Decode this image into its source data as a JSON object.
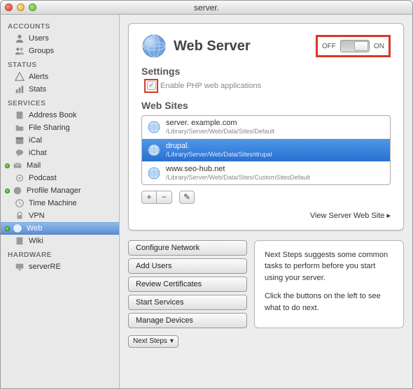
{
  "window": {
    "title": "server."
  },
  "sidebar": {
    "accounts_header": "ACCOUNTS",
    "accounts": [
      {
        "label": "Users"
      },
      {
        "label": "Groups"
      }
    ],
    "status_header": "STATUS",
    "status": [
      {
        "label": "Alerts"
      },
      {
        "label": "Stats"
      }
    ],
    "services_header": "SERVICES",
    "services": [
      {
        "label": "Address Book",
        "dot": false
      },
      {
        "label": "File Sharing",
        "dot": false
      },
      {
        "label": "iCal",
        "dot": false
      },
      {
        "label": "iChat",
        "dot": false
      },
      {
        "label": "Mail",
        "dot": true
      },
      {
        "label": "Podcast",
        "dot": false
      },
      {
        "label": "Profile Manager",
        "dot": true
      },
      {
        "label": "Time Machine",
        "dot": false
      },
      {
        "label": "VPN",
        "dot": false
      },
      {
        "label": "Web",
        "dot": true,
        "selected": true
      },
      {
        "label": "Wiki",
        "dot": false
      }
    ],
    "hardware_header": "HARDWARE",
    "hardware": [
      {
        "label": "serverRE"
      }
    ]
  },
  "panel": {
    "title": "Web Server",
    "switch": {
      "off": "OFF",
      "on": "ON"
    },
    "settings_title": "Settings",
    "enable_php_label": "Enable PHP web applications",
    "websites_title": "Web Sites",
    "sites": [
      {
        "name": "server. example.com",
        "path": "/Library/Server/Web/Data/Sites/Default",
        "selected": false
      },
      {
        "name": "drupal.",
        "path": "/Library/Server/Web/Data/Sites/drupal",
        "selected": true
      },
      {
        "name": "www.seo-hub.net",
        "path": "/Library/Server/Web/Data/Sites/CustomSitesDefault",
        "selected": false
      }
    ],
    "buttons": {
      "add": "+",
      "remove": "−",
      "edit": "✎"
    },
    "view_link": "View Server Web Site  ▸"
  },
  "footer": {
    "buttons": [
      "Configure Network",
      "Add Users",
      "Review Certificates",
      "Start Services",
      "Manage Devices"
    ],
    "next_steps_line1": "Next Steps suggests some common tasks to perform before you start using your server.",
    "next_steps_line2": "Click the buttons on the left to see what to do next."
  },
  "bottom": {
    "next_steps": "Next Steps"
  }
}
